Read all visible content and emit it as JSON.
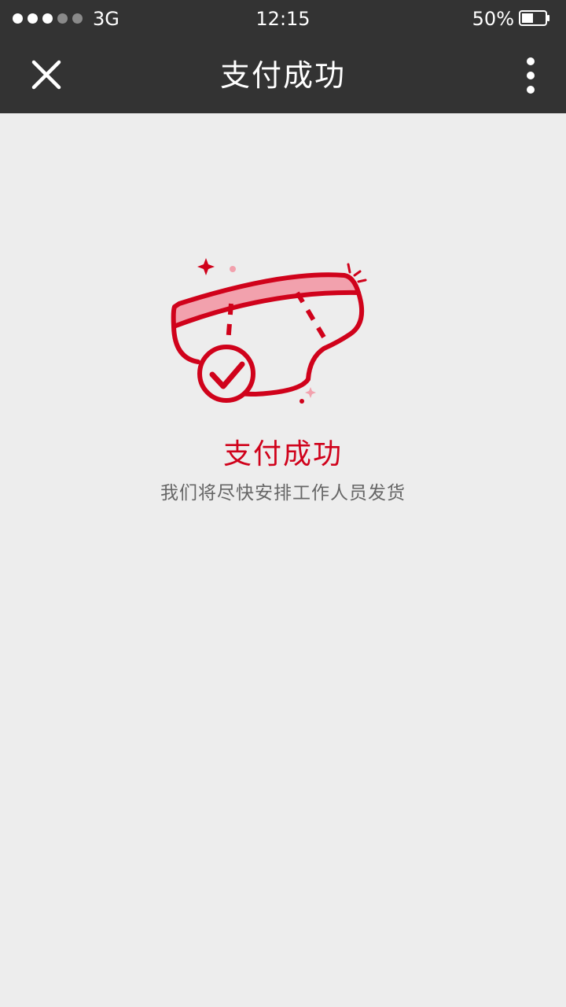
{
  "status_bar": {
    "signal_bars_filled": 3,
    "signal_bars_total": 5,
    "network": "3G",
    "time": "12:15",
    "battery_percent_label": "50%",
    "battery_level": 0.5
  },
  "nav": {
    "title": "支付成功",
    "close_icon": "close-icon",
    "more_icon": "more-vertical-icon"
  },
  "result": {
    "icon": "diaper-check-icon",
    "title": "支付成功",
    "subtitle": "我们将尽快安排工作人员发货"
  },
  "colors": {
    "bar_background": "#333333",
    "page_background": "#ededed",
    "accent_red": "#d0021b",
    "accent_pink": "#f2a1ad",
    "subtitle_gray": "#666666"
  }
}
